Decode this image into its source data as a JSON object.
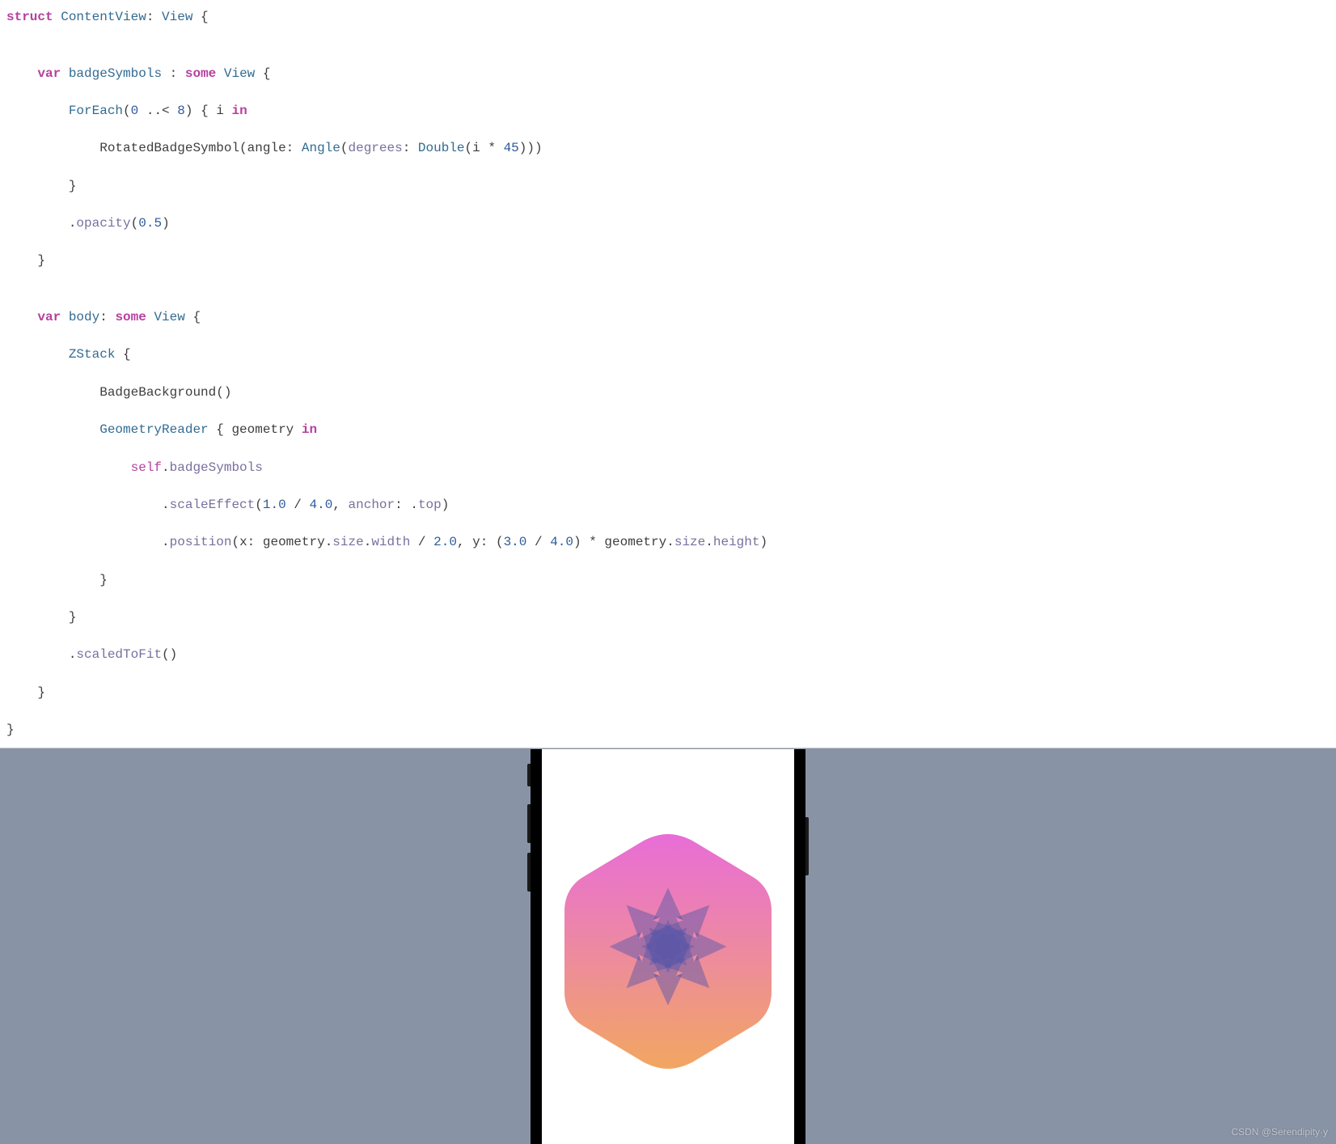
{
  "code": {
    "tokens": {
      "struct": "struct",
      "var": "var",
      "some": "some",
      "in": "in",
      "self": "self",
      "ContentView": "ContentView",
      "View": "View",
      "badgeSymbols": "badgeSymbols",
      "body": "body",
      "ForEach": "ForEach",
      "RotatedBadgeSymbol": "RotatedBadgeSymbol",
      "angle": "angle",
      "Angle": "Angle",
      "degrees": "degrees",
      "Double": "Double",
      "opacity": "opacity",
      "ZStack": "ZStack",
      "BadgeBackground": "BadgeBackground",
      "GeometryReader": "GeometryReader",
      "geometry": "geometry",
      "scaleEffect": "scaleEffect",
      "anchor": "anchor",
      "top": "top",
      "position": "position",
      "x": "x",
      "y": "y",
      "size": "size",
      "width": "width",
      "height": "height",
      "scaledToFit": "scaledToFit",
      "i": "i",
      "n0": "0",
      "n8": "8",
      "n45": "45",
      "n05": "0.5",
      "n1_0": "1.0",
      "n4_0": "4.0",
      "n2_0": "2.0",
      "n3_0": "3.0"
    }
  },
  "preview": {
    "badge": {
      "gradient_top": "#e86dd7",
      "gradient_bottom": "#f2a661",
      "symbol_color": "#5e57a8",
      "symbol_opacity": 0.5,
      "symbol_count": 8,
      "rotation_step": 45
    }
  },
  "watermark": "CSDN @Serendipity·y"
}
